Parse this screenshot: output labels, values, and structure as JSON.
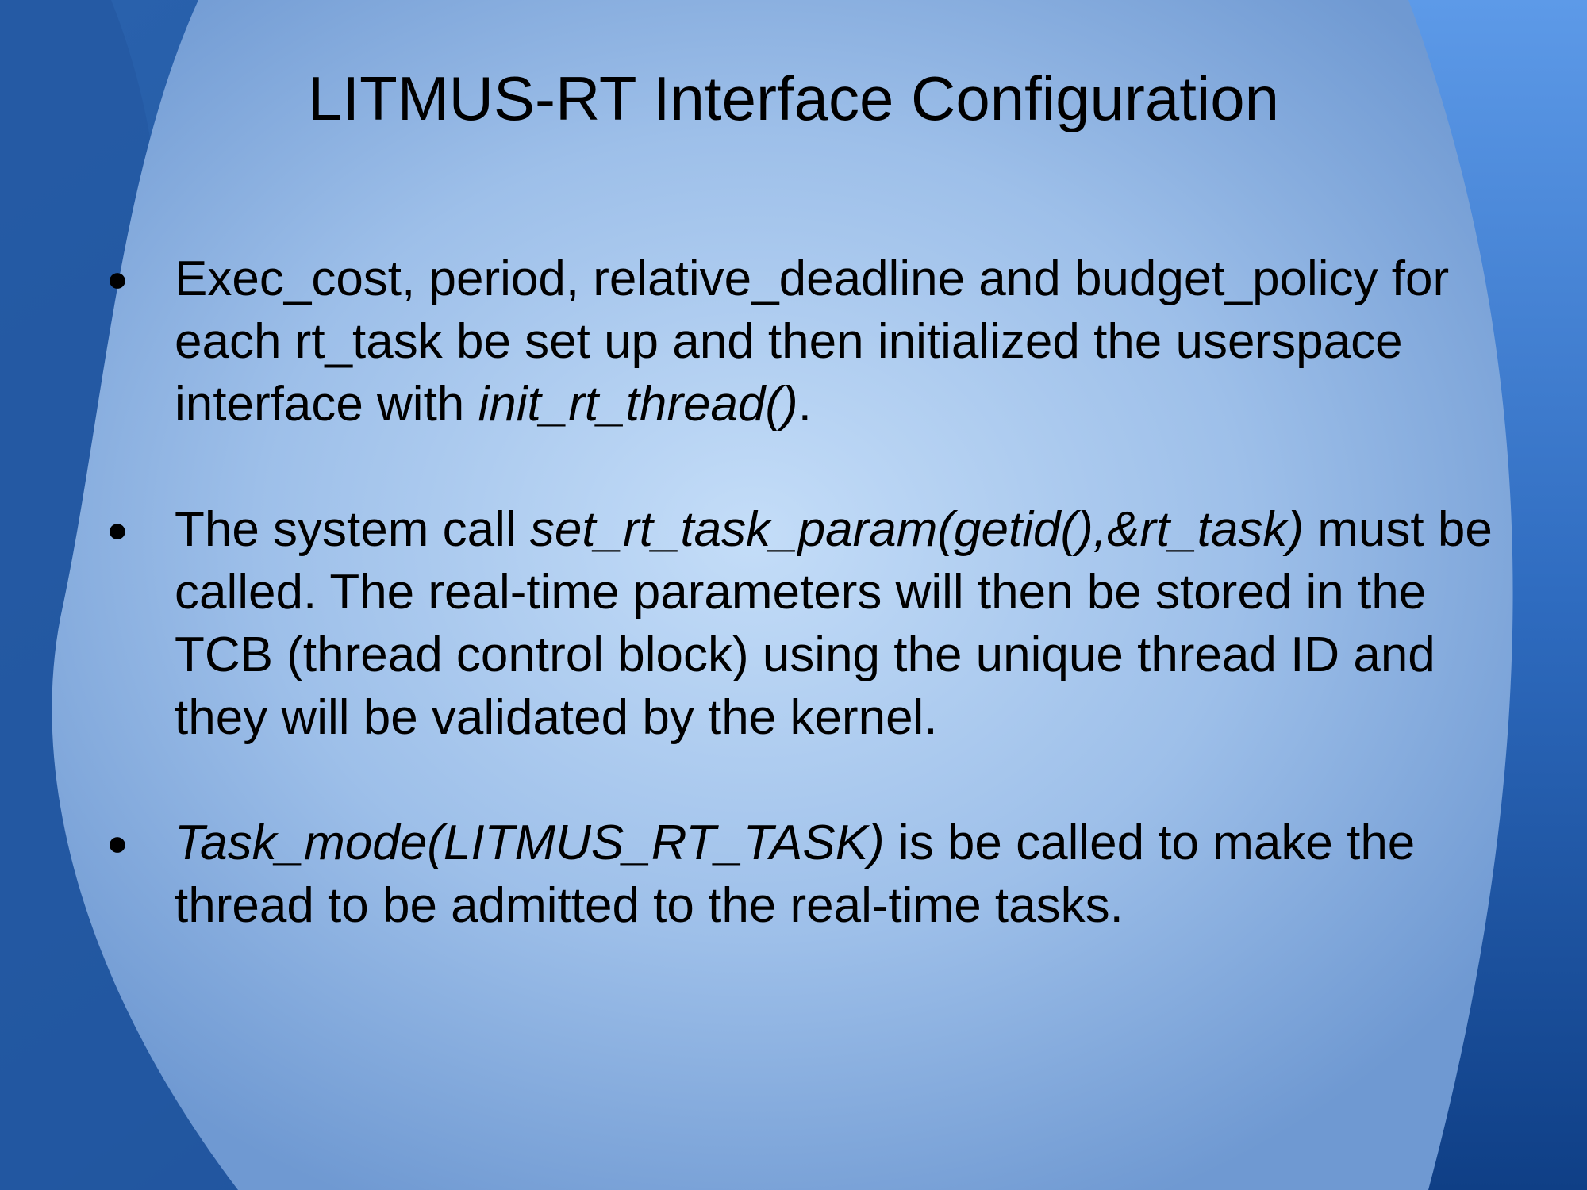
{
  "slide": {
    "title": "LITMUS-RT Interface Configuration",
    "bullet_glyph": "●",
    "bullets": [
      {
        "seg1": "Exec_cost, period, relative_deadline and budget_policy for each rt_task be set up and then initialized the userspace interface with ",
        "seg2_italic": "init_rt_thread()",
        "seg3": "."
      },
      {
        "seg1": "The system call ",
        "seg2_italic": "set_rt_task_param(getid(),&rt_task)",
        "seg3": " must be called. The real-time parameters will then be stored in the TCB (thread control block) using the unique thread ID and they will be validated by the kernel."
      },
      {
        "seg1_italic": "Task_mode(LITMUS_RT_TASK)",
        "seg2": " is be called to make the thread to be admitted to the real-time tasks."
      }
    ]
  },
  "theme": {
    "center_color": "#c2dbf7",
    "mid_color": "#86ace0",
    "edge_color": "#1b4f97",
    "text_color": "#000000"
  }
}
